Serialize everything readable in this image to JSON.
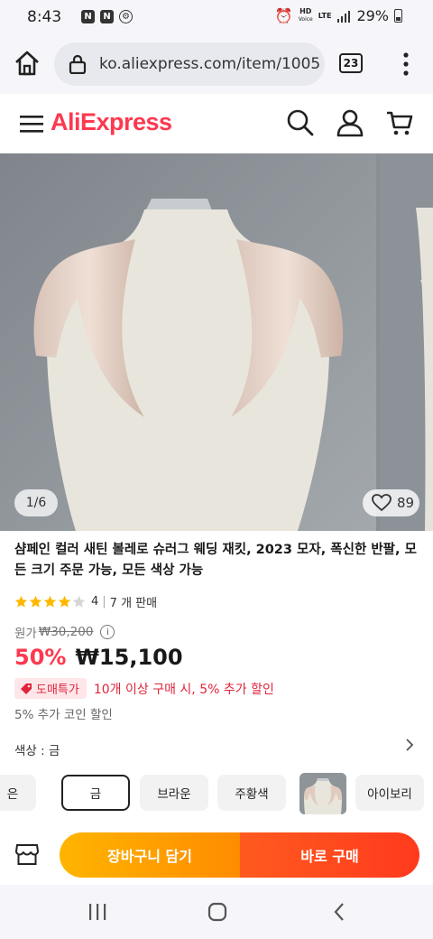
{
  "status_bar": {
    "time": "8:43",
    "battery": "29%",
    "icons": [
      "notification-n-icon",
      "notification-n-icon",
      "settings-app-icon",
      "alarm-icon",
      "hd-voice-icon",
      "lte-icon",
      "signal-icon",
      "battery-icon"
    ],
    "hd_label": "HD",
    "voice_label": "Voice",
    "lte_label": "LTE"
  },
  "browser": {
    "url": "ko.aliexpress.com/item/1005",
    "tab_count": "23"
  },
  "site": {
    "logo": "AliExpress"
  },
  "gallery": {
    "counter": "1/6",
    "likes": "89"
  },
  "product": {
    "title": "샴페인 컬러 새틴 볼레로 슈러그 웨딩 재킷, 2023 모자, 폭신한 반팔, 모든 크기 주문 가능, 모든 색상 가능",
    "rating": 4,
    "rating_text": "4",
    "sold": "7 개 판매",
    "original_price_label": "원가",
    "original_price": "₩30,200",
    "discount": "50%",
    "price": "₩15,100",
    "promo_tag": "도매특가",
    "promo_text": "10개 이상 구매 시, 5% 추가 할인",
    "coin_text": "5% 추가 코인 할인"
  },
  "colors": {
    "label": "색상 : 금",
    "options": [
      "은",
      "금",
      "브라운",
      "주황색",
      "아이보리"
    ],
    "selected": "금"
  },
  "actions": {
    "cart": "장바구니 담기",
    "buy": "바로 구매"
  },
  "colors_theme": {
    "brand": "#fd384f",
    "cart_button": "#ffa000",
    "buy_button": "#ff4a1e"
  }
}
